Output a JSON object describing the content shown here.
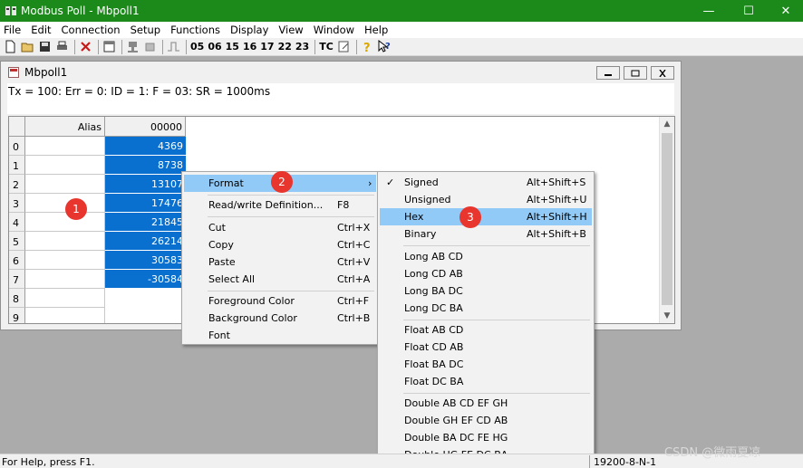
{
  "app": {
    "title": "Modbus Poll - Mbpoll1",
    "window_controls": {
      "minimize": "—",
      "maximize": "☐",
      "close": "✕"
    }
  },
  "menubar": [
    "File",
    "Edit",
    "Connection",
    "Setup",
    "Functions",
    "Display",
    "View",
    "Window",
    "Help"
  ],
  "toolbar": {
    "function_codes": [
      "05",
      "06",
      "15",
      "16",
      "17",
      "22",
      "23"
    ],
    "tc_label": "TC",
    "icons": [
      "new-icon",
      "open-icon",
      "save-icon",
      "print-icon",
      "delete-icon",
      "window-icon",
      "connect-icon",
      "disconnect-icon",
      "pulse-icon",
      "traffic-icon",
      "help-icon",
      "context-help-icon"
    ]
  },
  "child_window": {
    "title": "Mbpoll1",
    "status_line": "Tx = 100: Err = 0: ID = 1: F = 03: SR = 1000ms"
  },
  "grid": {
    "alias_header": "Alias",
    "column_header": "00000",
    "row_labels": [
      "0",
      "1",
      "2",
      "3",
      "4",
      "5",
      "6",
      "7",
      "8",
      "9"
    ],
    "values": [
      "4369",
      "8738",
      "13107",
      "17476",
      "21845",
      "26214",
      "30583",
      "-30584",
      "",
      ""
    ],
    "selected_rows": 8
  },
  "context_menu": {
    "items": [
      {
        "label": "Format",
        "shortcut": "",
        "submenu": true,
        "highlighted": true
      },
      {
        "label": "Read/write Definition...",
        "shortcut": "F8"
      },
      {
        "label": "Cut",
        "shortcut": "Ctrl+X"
      },
      {
        "label": "Copy",
        "shortcut": "Ctrl+C"
      },
      {
        "label": "Paste",
        "shortcut": "Ctrl+V"
      },
      {
        "label": "Select All",
        "shortcut": "Ctrl+A"
      },
      {
        "label": "Foreground Color",
        "shortcut": "Ctrl+F"
      },
      {
        "label": "Background Color",
        "shortcut": "Ctrl+B"
      },
      {
        "label": "Font",
        "shortcut": ""
      }
    ]
  },
  "format_submenu": {
    "items": [
      {
        "label": "Signed",
        "shortcut": "Alt+Shift+S",
        "checked": true
      },
      {
        "label": "Unsigned",
        "shortcut": "Alt+Shift+U"
      },
      {
        "label": "Hex",
        "shortcut": "Alt+Shift+H",
        "highlighted": true
      },
      {
        "label": "Binary",
        "shortcut": "Alt+Shift+B"
      },
      {
        "label": "Long AB CD"
      },
      {
        "label": "Long CD AB"
      },
      {
        "label": "Long BA DC"
      },
      {
        "label": "Long DC BA"
      },
      {
        "label": "Float AB CD"
      },
      {
        "label": "Float CD AB"
      },
      {
        "label": "Float BA DC"
      },
      {
        "label": "Float DC BA"
      },
      {
        "label": "Double AB CD EF GH"
      },
      {
        "label": "Double GH EF CD AB"
      },
      {
        "label": "Double BA DC FE HG"
      },
      {
        "label": "Double HG FE DC BA"
      }
    ]
  },
  "annotations": [
    "1",
    "2",
    "3"
  ],
  "statusbar": {
    "help": "For Help, press F1.",
    "comm": "19200-8-N-1"
  },
  "watermark": "CSDN @微雨夏凉",
  "colors": {
    "titlebar": "#1b8a1b",
    "selection": "#0a70d0",
    "menu_highlight": "#91c9f7",
    "badge": "#e8352d"
  }
}
